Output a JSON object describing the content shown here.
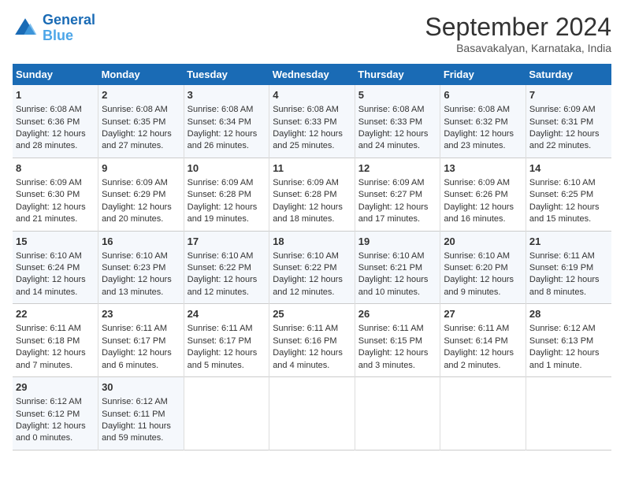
{
  "logo": {
    "line1": "General",
    "line2": "Blue"
  },
  "title": "September 2024",
  "subtitle": "Basavakalyan, Karnataka, India",
  "days_of_week": [
    "Sunday",
    "Monday",
    "Tuesday",
    "Wednesday",
    "Thursday",
    "Friday",
    "Saturday"
  ],
  "weeks": [
    [
      {
        "day": 1,
        "lines": [
          "Sunrise: 6:08 AM",
          "Sunset: 6:36 PM",
          "Daylight: 12 hours",
          "and 28 minutes."
        ]
      },
      {
        "day": 2,
        "lines": [
          "Sunrise: 6:08 AM",
          "Sunset: 6:35 PM",
          "Daylight: 12 hours",
          "and 27 minutes."
        ]
      },
      {
        "day": 3,
        "lines": [
          "Sunrise: 6:08 AM",
          "Sunset: 6:34 PM",
          "Daylight: 12 hours",
          "and 26 minutes."
        ]
      },
      {
        "day": 4,
        "lines": [
          "Sunrise: 6:08 AM",
          "Sunset: 6:33 PM",
          "Daylight: 12 hours",
          "and 25 minutes."
        ]
      },
      {
        "day": 5,
        "lines": [
          "Sunrise: 6:08 AM",
          "Sunset: 6:33 PM",
          "Daylight: 12 hours",
          "and 24 minutes."
        ]
      },
      {
        "day": 6,
        "lines": [
          "Sunrise: 6:08 AM",
          "Sunset: 6:32 PM",
          "Daylight: 12 hours",
          "and 23 minutes."
        ]
      },
      {
        "day": 7,
        "lines": [
          "Sunrise: 6:09 AM",
          "Sunset: 6:31 PM",
          "Daylight: 12 hours",
          "and 22 minutes."
        ]
      }
    ],
    [
      {
        "day": 8,
        "lines": [
          "Sunrise: 6:09 AM",
          "Sunset: 6:30 PM",
          "Daylight: 12 hours",
          "and 21 minutes."
        ]
      },
      {
        "day": 9,
        "lines": [
          "Sunrise: 6:09 AM",
          "Sunset: 6:29 PM",
          "Daylight: 12 hours",
          "and 20 minutes."
        ]
      },
      {
        "day": 10,
        "lines": [
          "Sunrise: 6:09 AM",
          "Sunset: 6:28 PM",
          "Daylight: 12 hours",
          "and 19 minutes."
        ]
      },
      {
        "day": 11,
        "lines": [
          "Sunrise: 6:09 AM",
          "Sunset: 6:28 PM",
          "Daylight: 12 hours",
          "and 18 minutes."
        ]
      },
      {
        "day": 12,
        "lines": [
          "Sunrise: 6:09 AM",
          "Sunset: 6:27 PM",
          "Daylight: 12 hours",
          "and 17 minutes."
        ]
      },
      {
        "day": 13,
        "lines": [
          "Sunrise: 6:09 AM",
          "Sunset: 6:26 PM",
          "Daylight: 12 hours",
          "and 16 minutes."
        ]
      },
      {
        "day": 14,
        "lines": [
          "Sunrise: 6:10 AM",
          "Sunset: 6:25 PM",
          "Daylight: 12 hours",
          "and 15 minutes."
        ]
      }
    ],
    [
      {
        "day": 15,
        "lines": [
          "Sunrise: 6:10 AM",
          "Sunset: 6:24 PM",
          "Daylight: 12 hours",
          "and 14 minutes."
        ]
      },
      {
        "day": 16,
        "lines": [
          "Sunrise: 6:10 AM",
          "Sunset: 6:23 PM",
          "Daylight: 12 hours",
          "and 13 minutes."
        ]
      },
      {
        "day": 17,
        "lines": [
          "Sunrise: 6:10 AM",
          "Sunset: 6:22 PM",
          "Daylight: 12 hours",
          "and 12 minutes."
        ]
      },
      {
        "day": 18,
        "lines": [
          "Sunrise: 6:10 AM",
          "Sunset: 6:22 PM",
          "Daylight: 12 hours",
          "and 12 minutes."
        ]
      },
      {
        "day": 19,
        "lines": [
          "Sunrise: 6:10 AM",
          "Sunset: 6:21 PM",
          "Daylight: 12 hours",
          "and 10 minutes."
        ]
      },
      {
        "day": 20,
        "lines": [
          "Sunrise: 6:10 AM",
          "Sunset: 6:20 PM",
          "Daylight: 12 hours",
          "and 9 minutes."
        ]
      },
      {
        "day": 21,
        "lines": [
          "Sunrise: 6:11 AM",
          "Sunset: 6:19 PM",
          "Daylight: 12 hours",
          "and 8 minutes."
        ]
      }
    ],
    [
      {
        "day": 22,
        "lines": [
          "Sunrise: 6:11 AM",
          "Sunset: 6:18 PM",
          "Daylight: 12 hours",
          "and 7 minutes."
        ]
      },
      {
        "day": 23,
        "lines": [
          "Sunrise: 6:11 AM",
          "Sunset: 6:17 PM",
          "Daylight: 12 hours",
          "and 6 minutes."
        ]
      },
      {
        "day": 24,
        "lines": [
          "Sunrise: 6:11 AM",
          "Sunset: 6:17 PM",
          "Daylight: 12 hours",
          "and 5 minutes."
        ]
      },
      {
        "day": 25,
        "lines": [
          "Sunrise: 6:11 AM",
          "Sunset: 6:16 PM",
          "Daylight: 12 hours",
          "and 4 minutes."
        ]
      },
      {
        "day": 26,
        "lines": [
          "Sunrise: 6:11 AM",
          "Sunset: 6:15 PM",
          "Daylight: 12 hours",
          "and 3 minutes."
        ]
      },
      {
        "day": 27,
        "lines": [
          "Sunrise: 6:11 AM",
          "Sunset: 6:14 PM",
          "Daylight: 12 hours",
          "and 2 minutes."
        ]
      },
      {
        "day": 28,
        "lines": [
          "Sunrise: 6:12 AM",
          "Sunset: 6:13 PM",
          "Daylight: 12 hours",
          "and 1 minute."
        ]
      }
    ],
    [
      {
        "day": 29,
        "lines": [
          "Sunrise: 6:12 AM",
          "Sunset: 6:12 PM",
          "Daylight: 12 hours",
          "and 0 minutes."
        ]
      },
      {
        "day": 30,
        "lines": [
          "Sunrise: 6:12 AM",
          "Sunset: 6:11 PM",
          "Daylight: 11 hours",
          "and 59 minutes."
        ]
      },
      null,
      null,
      null,
      null,
      null
    ]
  ]
}
